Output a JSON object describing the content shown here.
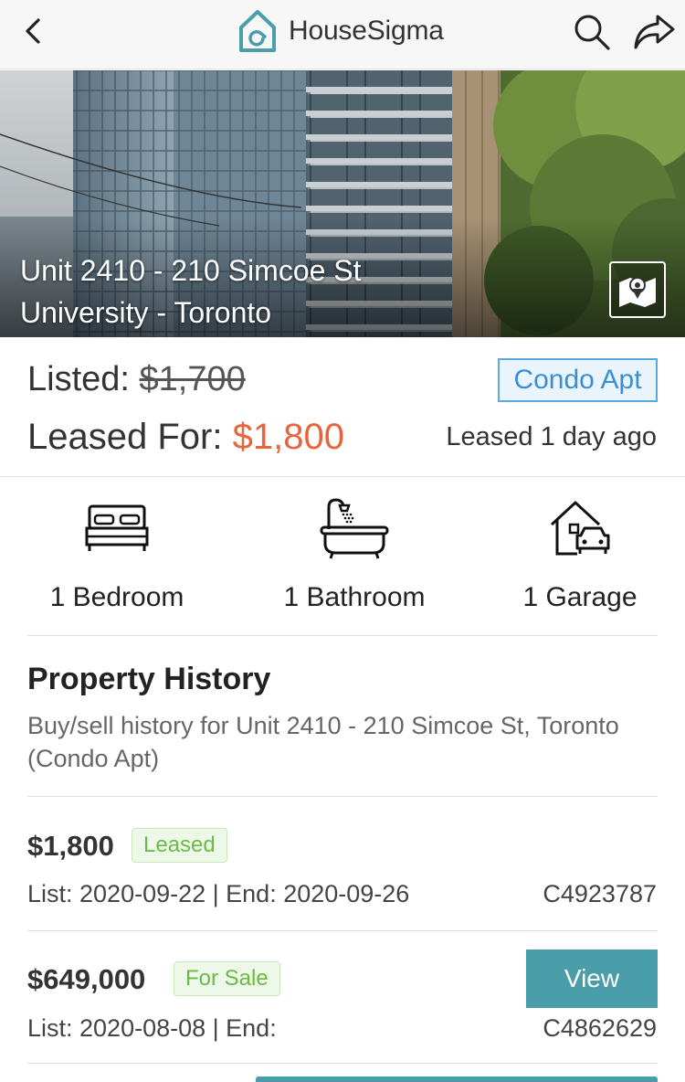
{
  "header": {
    "brand_name": "HouseSigma"
  },
  "hero": {
    "line1": "Unit 2410 - 210 Simcoe St",
    "line2": "University - Toronto"
  },
  "pricing": {
    "listed_label": "Listed:",
    "listed_price": "$1,700",
    "leased_label": "Leased For:",
    "leased_price": "$1,800",
    "property_type": "Condo Apt",
    "leased_ago": "Leased 1 day ago"
  },
  "features": [
    {
      "label": "1 Bedroom",
      "icon": "bed-icon"
    },
    {
      "label": "1 Bathroom",
      "icon": "bathtub-icon"
    },
    {
      "label": "1 Garage",
      "icon": "garage-icon"
    }
  ],
  "history": {
    "title": "Property History",
    "subtitle": "Buy/sell history for Unit 2410 - 210 Simcoe St, Toronto (Condo Apt)",
    "rows": [
      {
        "price": "$1,800",
        "status": "Leased",
        "dates": "List: 2020-09-22 | End: 2020-09-26",
        "mls": "C4923787"
      },
      {
        "price": "$649,000",
        "status": "For Sale",
        "dates": "List: 2020-08-08 | End:",
        "mls": "C4862629",
        "action": "View"
      }
    ]
  },
  "colors": {
    "accent": "#4a9eaa",
    "price_highlight": "#e8643c",
    "badge_blue": "#3a8fd4",
    "status_green": "#6abb46"
  }
}
